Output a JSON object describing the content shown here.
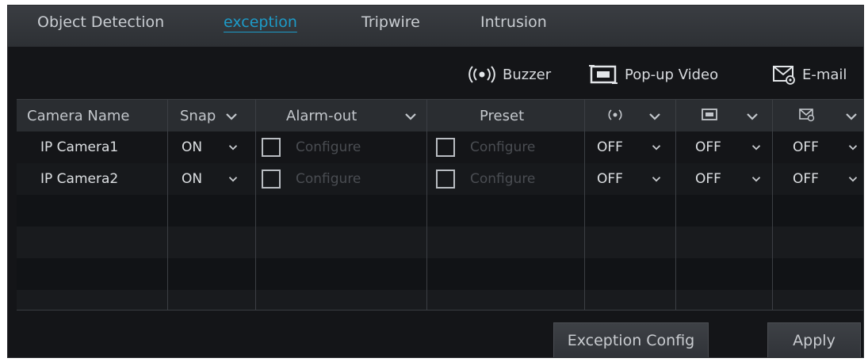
{
  "tabs": [
    {
      "label": "Object Detection"
    },
    {
      "label": "exception"
    },
    {
      "label": "Tripwire"
    },
    {
      "label": "Intrusion"
    }
  ],
  "active_tab": "exception",
  "legend": {
    "buzzer_label": "Buzzer",
    "popup_label": "Pop-up Video",
    "email_label": "E-mail"
  },
  "table": {
    "headers": {
      "camera_name": "Camera Name",
      "snap": "Snap",
      "alarm_out": "Alarm-out",
      "preset": "Preset"
    },
    "rows": [
      {
        "camera": "IP Camera1",
        "snap": "ON",
        "alarm_out": "Configure",
        "preset": "Configure",
        "buzzer": "OFF",
        "popup": "OFF",
        "email": "OFF"
      },
      {
        "camera": "IP Camera2",
        "snap": "ON",
        "alarm_out": "Configure",
        "preset": "Configure",
        "buzzer": "OFF",
        "popup": "OFF",
        "email": "OFF"
      }
    ]
  },
  "buttons": {
    "exception_config": "Exception Config",
    "apply": "Apply"
  },
  "colors": {
    "accent": "#1d9bc8",
    "panel_bg": "#141518",
    "text": "#d7dade"
  },
  "icons": [
    "buzzer-icon",
    "popup-video-icon",
    "email-icon",
    "chevron-down-icon"
  ]
}
